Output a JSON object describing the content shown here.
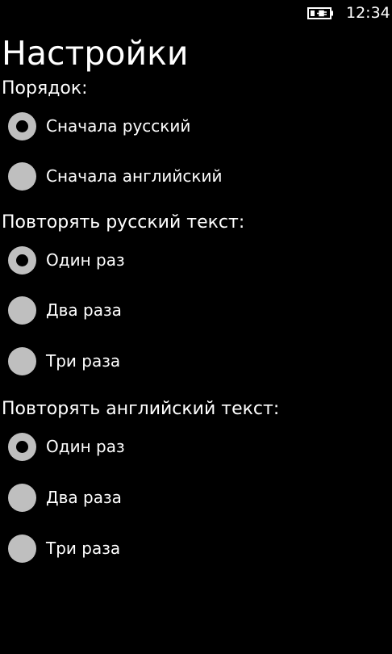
{
  "status_bar": {
    "time": "12:34",
    "battery_icon": "battery-charging-icon"
  },
  "page": {
    "title": "Настройки"
  },
  "order": {
    "header": "Порядок:",
    "options": [
      {
        "label": "Сначала русский",
        "selected": true
      },
      {
        "label": "Сначала английский",
        "selected": false
      }
    ]
  },
  "repeat_russian": {
    "header": "Повторять русский текст:",
    "options": [
      {
        "label": "Один раз",
        "selected": true
      },
      {
        "label": "Два раза",
        "selected": false
      },
      {
        "label": "Три раза",
        "selected": false
      }
    ]
  },
  "repeat_english": {
    "header": "Повторять английский текст:",
    "options": [
      {
        "label": "Один раз",
        "selected": true
      },
      {
        "label": "Два раза",
        "selected": false
      },
      {
        "label": "Три раза",
        "selected": false
      }
    ]
  },
  "colors": {
    "background": "#000000",
    "text": "#ffffff",
    "radio": "#bfbfbf"
  }
}
